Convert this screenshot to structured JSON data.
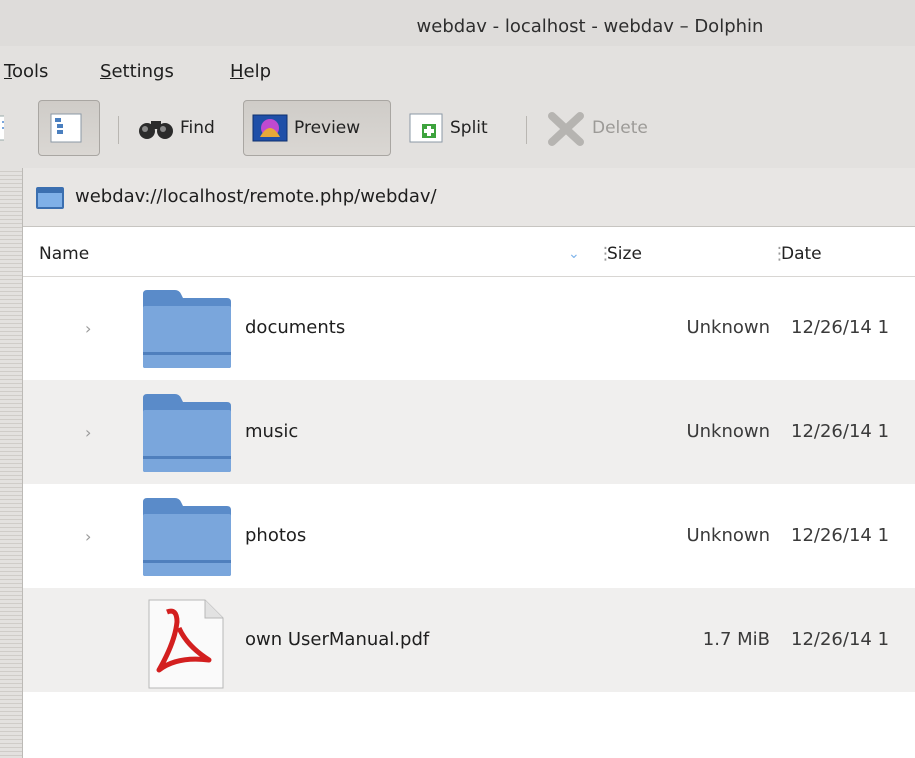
{
  "window": {
    "title": "webdav - localhost - webdav – Dolphin"
  },
  "menu": [
    {
      "id": "tools",
      "label": "ools",
      "prefix": "T"
    },
    {
      "id": "settings",
      "label": "ettings",
      "prefix": "S"
    },
    {
      "id": "help",
      "label": "elp",
      "prefix": "H"
    }
  ],
  "toolbar": {
    "find_label": "Find",
    "preview_label": "Preview",
    "split_label": "Split",
    "delete_label": "Delete"
  },
  "location": {
    "url": "webdav://localhost/remote.php/webdav/"
  },
  "columns": {
    "name": "Name",
    "size": "Size",
    "date": "Date"
  },
  "files": [
    {
      "name": "documents",
      "size": "Unknown",
      "date": "12/26/14 1",
      "type": "folder"
    },
    {
      "name": "music",
      "size": "Unknown",
      "date": "12/26/14 1",
      "type": "folder"
    },
    {
      "name": "photos",
      "size": "Unknown",
      "date": "12/26/14 1",
      "type": "folder"
    },
    {
      "name": "own UserManual.pdf",
      "size": "1.7 MiB",
      "date": "12/26/14 1",
      "type": "pdf"
    }
  ],
  "colors": {
    "folder": "#6d9bd6",
    "accent": "#7aa6dc",
    "pdf_red": "#d31f1f"
  }
}
